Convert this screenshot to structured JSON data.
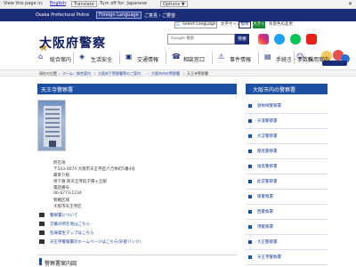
{
  "translate_bar": {
    "view_label": "View this page in:",
    "language": "English",
    "translate_button": "Translate",
    "turn_off": "Turn off for: Japanese",
    "options": "Options ▼"
  },
  "top_strip": {
    "site_name": "Osaka Prefectural Police",
    "foreign_language": "Foreign Language",
    "links": "ご意見・ご要望"
  },
  "header": {
    "logo": "大阪府警察",
    "select_language": "Select Language",
    "text_size": "文字サイズ",
    "size_std": "標準",
    "size_large": "大きく",
    "reading": "背景色の変更",
    "search_placeholder": "Google 検索",
    "search_button": "検索",
    "social": [
      "instagram-icon",
      "twitter-icon",
      "line-icon",
      "youtube-icon"
    ]
  },
  "nav": [
    {
      "label": "総合案内",
      "icon": "home-icon"
    },
    {
      "label": "生活安全",
      "icon": "shield-icon"
    },
    {
      "label": "交通情報",
      "icon": "car-icon"
    },
    {
      "label": "相談窓口",
      "icon": "phone-icon"
    },
    {
      "label": "事件情報",
      "icon": "alert-icon"
    },
    {
      "label": "手続き・手数料",
      "icon": "document-icon"
    },
    {
      "label": "採用案内",
      "icon": "person-icon"
    }
  ],
  "breadcrumb": [
    "現在の位置",
    "ホーム",
    "総合案内",
    "大阪府下警察署等のご案内",
    "大阪市内の警察署",
    "天王寺警察署"
  ],
  "main": {
    "title": "天王寺警察署",
    "info": [
      "所在地",
      "〒543-0074 大阪市天王寺区六万体町5番4号",
      "最寄り駅",
      "地下鉄 四天王寺前夕陽ヶ丘駅",
      "電話番号",
      "06-6773-1234",
      "管轄区域",
      "大阪市天王寺区"
    ],
    "links": [
      "警察署について",
      "交番の所在地はこちら",
      "犯罪発生マップはこちら",
      "天王寺警察署のホームページはこちら(外部リンク)"
    ],
    "section": "警察署案内図"
  },
  "side": {
    "title": "大阪市内の警察署",
    "items": [
      "曽根崎警察署",
      "天満警察署",
      "大淀警察署",
      "都島警察署",
      "福島警察署",
      "此花警察署",
      "東警察署",
      "西警察署",
      "港警察署",
      "大正警察署",
      "天王寺警察署"
    ]
  }
}
